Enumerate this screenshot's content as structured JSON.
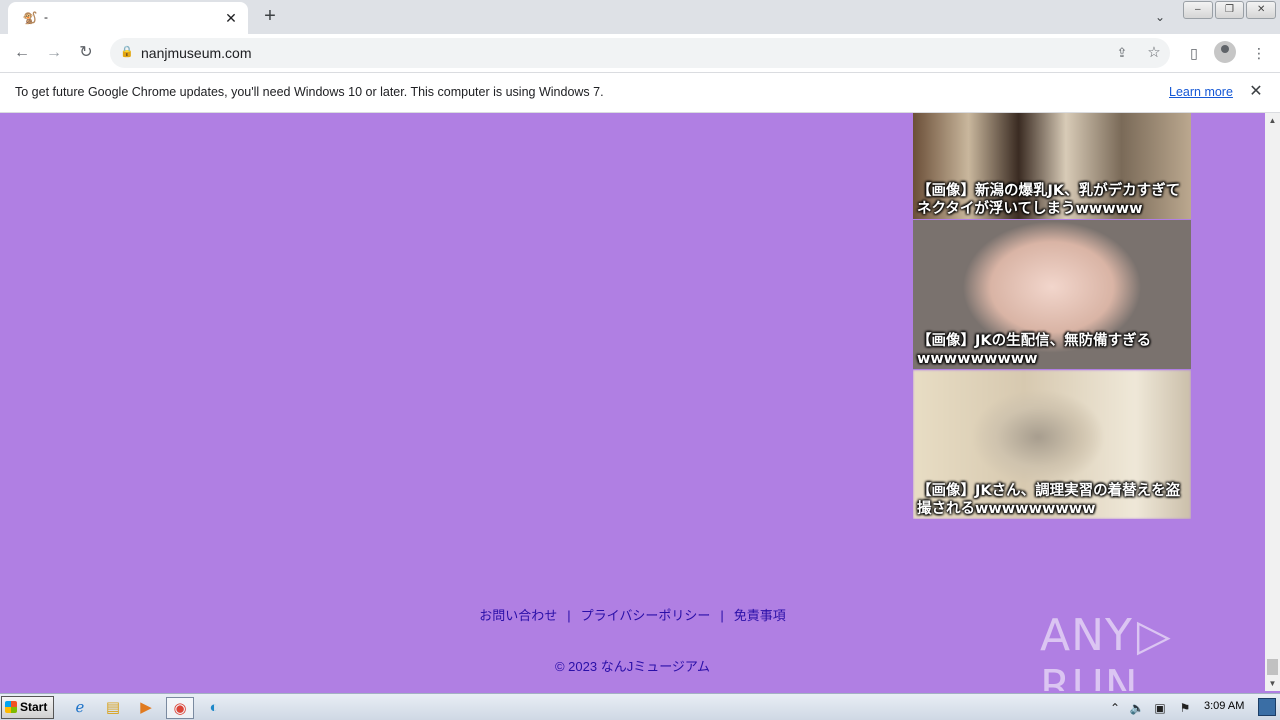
{
  "browser": {
    "tab_title": "-",
    "tab_favicon": "🐒",
    "new_tab": "+",
    "close_tab": "✕",
    "url": "nanjmuseum.com"
  },
  "infobar": {
    "message": "To get future Google Chrome updates, you'll need Windows 10 or later. This computer is using Windows 7.",
    "learn_more": "Learn more"
  },
  "articles": [
    {
      "caption": "【画像】新潟の爆乳JK、乳がデカすぎてネクタイが浮いてしまうwwwww"
    },
    {
      "caption": "【画像】JKの生配信、無防備すぎるwwwwwwwww"
    },
    {
      "caption": "【画像】JKさん、調理実習の着替えを盗撮されるwwwwwwwww"
    }
  ],
  "footer": {
    "links": [
      "お問い合わせ",
      "プライバシーポリシー",
      "免責事項"
    ],
    "copyright": "© 2023 なんJミュージアム"
  },
  "watermark": {
    "left": "ANY",
    "right": "RUN"
  },
  "taskbar": {
    "start_label": "Start",
    "clock": "3:09 AM"
  }
}
